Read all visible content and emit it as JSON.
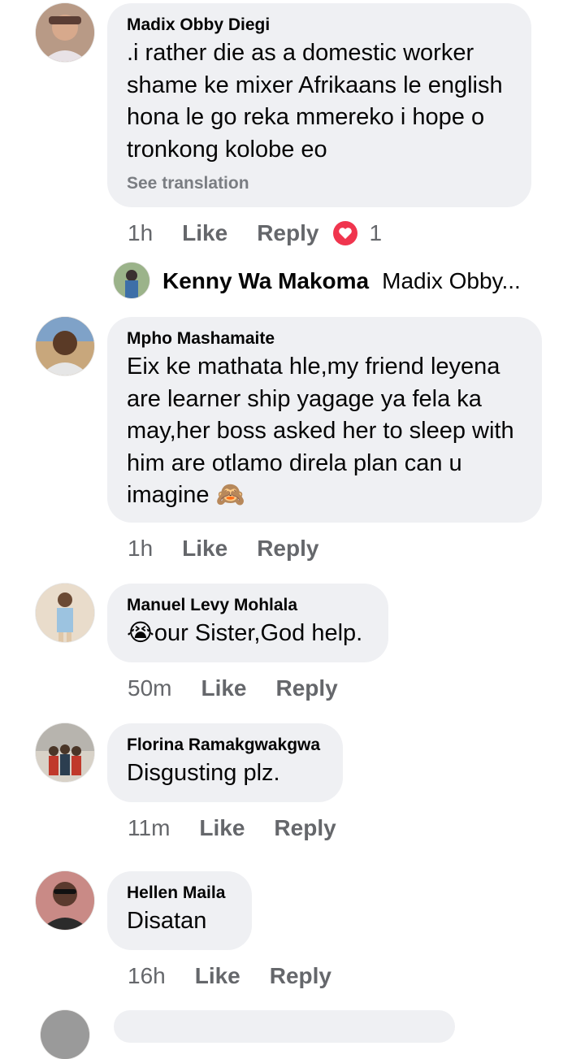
{
  "comments": [
    {
      "author": "Madix Obby Diegi",
      "text": ".i rather die as a domestic worker shame ke mixer Afrikaans le english hona le go reka mmereko i hope o tronkong kolobe eo",
      "see_translation": "See translation",
      "time": "1h",
      "like": "Like",
      "reply": "Reply",
      "reaction_count": "1",
      "reaction_icon": "love-reaction-icon",
      "reaction_color": "#f0354e"
    },
    {
      "author": "Mpho Mashamaite",
      "text": "Eix ke mathata hle,my friend leyena are learner ship yagage ya fela ka may,her boss asked her to sleep with him are otlamo direla plan can u imagine 🙈",
      "time": "1h",
      "like": "Like",
      "reply": "Reply"
    },
    {
      "author": "Manuel Levy Mohlala",
      "text": "😭our Sister,God help.",
      "time": "50m",
      "like": "Like",
      "reply": "Reply"
    },
    {
      "author": "Florina Ramakgwakgwa",
      "text": "Disgusting plz.",
      "time": "11m",
      "like": "Like",
      "reply": "Reply"
    },
    {
      "author": "Hellen Maila",
      "text": "Disatan",
      "time": "16h",
      "like": "Like",
      "reply": "Reply"
    }
  ],
  "reply_preview": {
    "author": "Kenny Wa Makoma",
    "snippet": "Madix Obby..."
  },
  "colors": {
    "bubble": "#eff0f3",
    "secondary_text": "#65676b",
    "primary_text": "#050505"
  }
}
